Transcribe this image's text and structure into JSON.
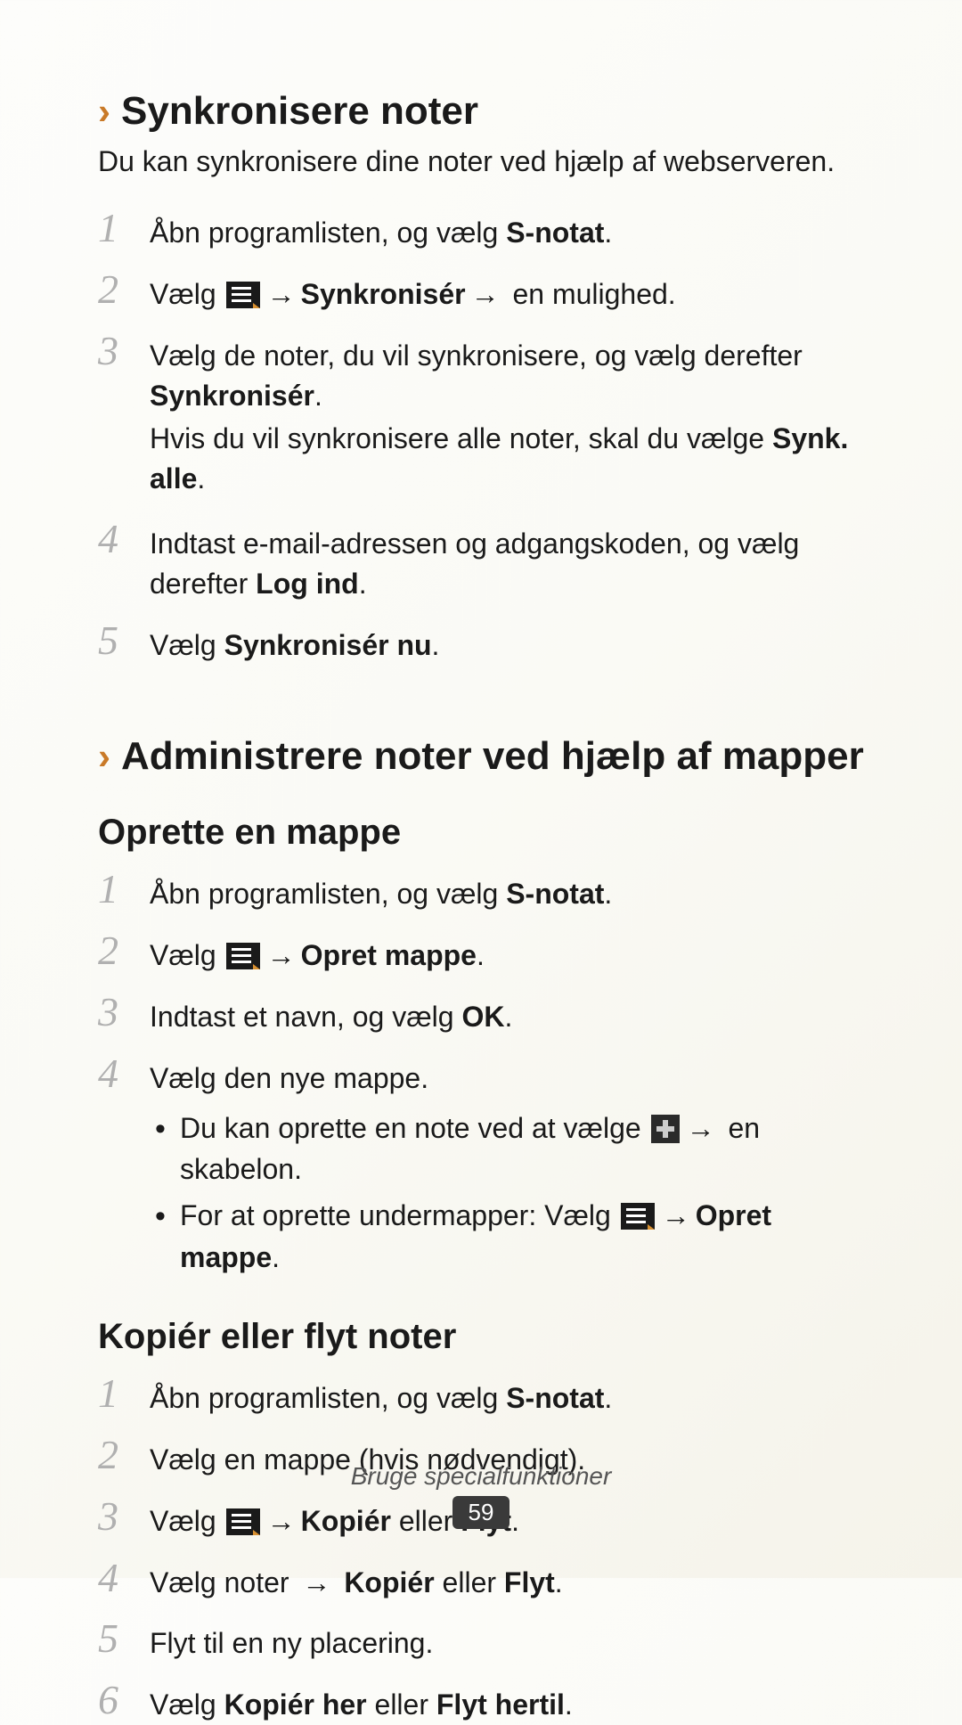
{
  "section1": {
    "title": "Synkronisere noter",
    "intro": "Du kan synkronisere dine noter ved hjælp af webserveren.",
    "steps": {
      "s1a": "Åbn programlisten, og vælg ",
      "s1b": "S-notat",
      "s1c": ".",
      "s2a": "Vælg ",
      "s2b": "Synkronisér",
      "s2c": " en mulighed.",
      "s3a": "Vælg de noter, du vil synkronisere, og vælg derefter ",
      "s3b": "Synkronisér",
      "s3c": ".",
      "s3d": "Hvis du vil synkronisere alle noter, skal du vælge ",
      "s3e": "Synk. alle",
      "s3f": ".",
      "s4a": "Indtast e-mail-adressen og adgangskoden, og vælg derefter ",
      "s4b": "Log ind",
      "s4c": ".",
      "s5a": "Vælg ",
      "s5b": "Synkronisér nu",
      "s5c": "."
    }
  },
  "section2": {
    "title": "Administrere noter ved hjælp af mapper",
    "sub1": {
      "heading": "Oprette en mappe",
      "s1a": "Åbn programlisten, og vælg ",
      "s1b": "S-notat",
      "s1c": ".",
      "s2a": "Vælg ",
      "s2b": "Opret mappe",
      "s2c": ".",
      "s3a": "Indtast et navn, og vælg ",
      "s3b": "OK",
      "s3c": ".",
      "s4a": "Vælg den nye mappe.",
      "b1a": "Du kan oprette en note ved at vælge ",
      "b1b": " en skabelon.",
      "b2a": "For at oprette undermapper: Vælg ",
      "b2b": "Opret mappe",
      "b2c": "."
    },
    "sub2": {
      "heading": "Kopiér eller flyt noter",
      "s1a": "Åbn programlisten, og vælg ",
      "s1b": "S-notat",
      "s1c": ".",
      "s2a": "Vælg en mappe (hvis nødvendigt).",
      "s3a": "Vælg ",
      "s3b": "Kopiér",
      "s3c": " eller ",
      "s3d": "Flyt",
      "s3e": ".",
      "s4a": "Vælg noter ",
      "s4b": "Kopiér",
      "s4c": " eller ",
      "s4d": "Flyt",
      "s4e": ".",
      "s5a": "Flyt til en ny placering.",
      "s6a": "Vælg ",
      "s6b": "Kopiér her",
      "s6c": " eller ",
      "s6d": "Flyt hertil",
      "s6e": "."
    }
  },
  "arrow": "→",
  "footer": {
    "text": "Bruge specialfunktioner",
    "page": "59"
  },
  "nums": {
    "n1": "1",
    "n2": "2",
    "n3": "3",
    "n4": "4",
    "n5": "5",
    "n6": "6"
  }
}
